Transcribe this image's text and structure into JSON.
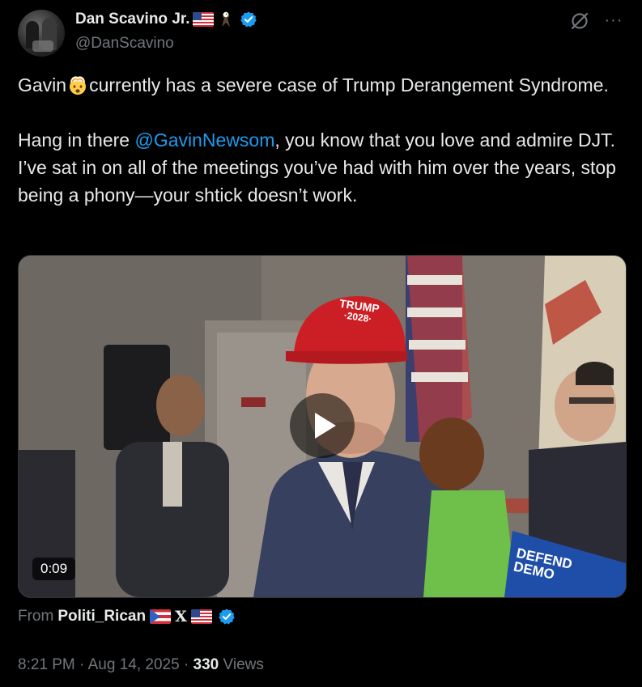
{
  "author": {
    "name": "Dan Scavino Jr.",
    "handle": "@DanScavino",
    "name_badges": [
      "us-flag-icon",
      "eagle-icon",
      "verified-badge-icon"
    ]
  },
  "header_actions": {
    "grok_icon": "grok-icon",
    "more_icon": "more-dots-icon",
    "more_label": "···"
  },
  "tweet": {
    "para1_before_emoji": "Gavin",
    "para1_emoji": "exploding-head-icon",
    "para1_after_emoji": "currently has a severe case of Trump Derangement Syndrome.",
    "para2_start": "Hang in there ",
    "para2_mention": "@GavinNewsom",
    "para2_rest": ", you know that you love and admire DJT. I’ve sat in on all of the meetings you’ve had with him over the years, stop being a phony—your shtick doesn’t work."
  },
  "media": {
    "duration": "0:09",
    "play_icon": "play-icon",
    "hat_text_line1": "TRUMP",
    "hat_text_line2": "·2028·",
    "sign_text_line1": "DEFEND",
    "sign_text_line2": "DEMO"
  },
  "source": {
    "prefix": "From",
    "account_name": "Politi_Rican",
    "x_glyph": "X",
    "badges": [
      "puerto-rico-flag-icon",
      "x-icon",
      "us-flag-icon",
      "verified-badge-icon"
    ]
  },
  "meta": {
    "time": "8:21 PM",
    "separator1": " · ",
    "date": "Aug 14, 2025",
    "separator2": " · ",
    "views_count": "330",
    "views_label": " Views"
  },
  "colors": {
    "background": "#000000",
    "text_primary": "#e7e9ea",
    "text_secondary": "#71767b",
    "link": "#1d9bf0",
    "verified": "#1d9bf0"
  }
}
